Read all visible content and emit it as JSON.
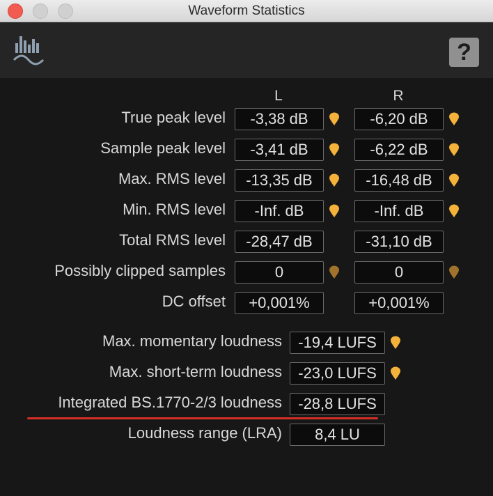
{
  "window": {
    "title": "Waveform Statistics"
  },
  "toolbar": {
    "app_icon": "waveform-statistics-icon",
    "help_label": "?"
  },
  "columns": {
    "left": "L",
    "right": "R"
  },
  "channel_stats": [
    {
      "label": "True peak level",
      "left": "-3,38 dB",
      "right": "-6,20 dB"
    },
    {
      "label": "Sample peak level",
      "left": "-3,41 dB",
      "right": "-6,22 dB"
    },
    {
      "label": "Max. RMS level",
      "left": "-13,35 dB",
      "right": "-16,48 dB"
    },
    {
      "label": "Min. RMS level",
      "left": "-Inf. dB",
      "right": "-Inf. dB"
    },
    {
      "label": "Total RMS level",
      "left": "-28,47 dB",
      "right": "-31,10 dB"
    },
    {
      "label": "Possibly clipped samples",
      "left": "0",
      "right": "0"
    },
    {
      "label": "DC offset",
      "left": "+0,001%",
      "right": "+0,001%"
    }
  ],
  "loudness_stats": [
    {
      "label": "Max. momentary loudness",
      "value": "-19,4 LUFS"
    },
    {
      "label": "Max. short-term loudness",
      "value": "-23,0 LUFS"
    },
    {
      "label": "Integrated BS.1770-2/3 loudness",
      "value": "-28,8 LUFS"
    },
    {
      "label": "Loudness range (LRA)",
      "value": "8,4 LU"
    }
  ],
  "colors": {
    "pin": "#f4b23a",
    "pin_dim": "#a0732c",
    "highlight": "#d42f24"
  }
}
